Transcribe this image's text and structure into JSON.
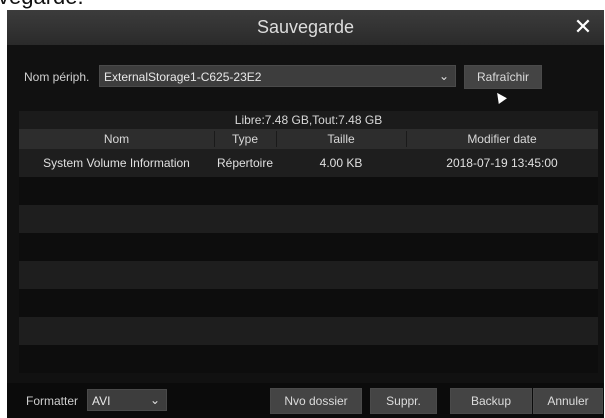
{
  "page_top_text": "vegarde.",
  "dialog": {
    "title": "Sauvegarde",
    "close_icon": "close-icon"
  },
  "device": {
    "label": "Nom périph.",
    "value": "ExternalStorage1-C625-23E2",
    "refresh_label": "Rafraîchir"
  },
  "table": {
    "free_space": "Libre:7.48 GB,Tout:7.48 GB",
    "headers": [
      "Nom",
      "Type",
      "Taille",
      "Modifier date"
    ],
    "rows": [
      {
        "name": "System Volume Information",
        "type": "Répertoire",
        "size": "4.00 KB",
        "date": "2018-07-19 13:45:00"
      }
    ]
  },
  "bottom": {
    "format_label": "Formatter",
    "format_value": "AVI",
    "new_folder": "Nvo dossier",
    "delete": "Suppr.",
    "backup": "Backup",
    "cancel": "Annuler"
  }
}
